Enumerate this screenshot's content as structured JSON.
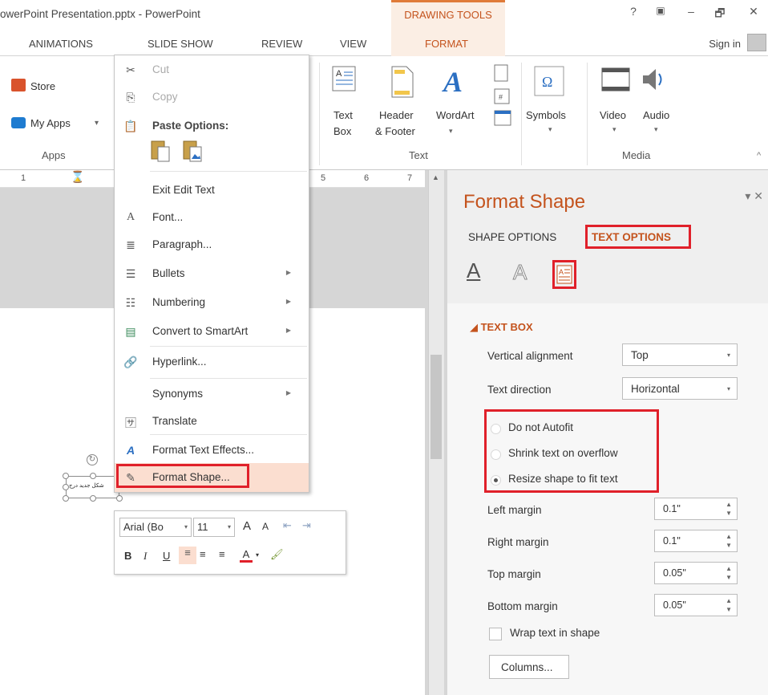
{
  "titlebar": {
    "title": "owerPoint Presentation.pptx - PowerPoint",
    "contextual_group": "DRAWING TOOLS",
    "help": "?",
    "ribbon_display": "▣",
    "minimize": "–",
    "restore": "🗗",
    "close": "✕"
  },
  "tabs": {
    "animations": "ANIMATIONS",
    "slide_show": "SLIDE SHOW",
    "review": "REVIEW",
    "view": "VIEW",
    "format": "FORMAT",
    "sign_in": "Sign in"
  },
  "ribbon": {
    "store": "Store",
    "my_apps": "My Apps",
    "my_apps_dd": "▾",
    "apps_group": "Apps",
    "text_box_line1": "Text",
    "text_box_line2": "Box",
    "header_line1": "Header",
    "header_line2": "& Footer",
    "wordart": "WordArt",
    "text_group": "Text",
    "symbols": "Symbols",
    "video": "Video",
    "audio": "Audio",
    "media_group": "Media",
    "collapse": "^"
  },
  "ruler": {
    "n1": "1",
    "n5": "5",
    "n6": "6",
    "n7": "7"
  },
  "context_menu": {
    "cut": "Cut",
    "copy": "Copy",
    "paste_options": "Paste Options:",
    "exit_edit_text": "Exit Edit Text",
    "font": "Font...",
    "paragraph": "Paragraph...",
    "bullets": "Bullets",
    "numbering": "Numbering",
    "convert_smartart": "Convert to SmartArt",
    "hyperlink": "Hyperlink...",
    "synonyms": "Synonyms",
    "translate": "Translate",
    "format_text_effects": "Format Text Effects...",
    "format_shape": "Format Shape..."
  },
  "mini_toolbar": {
    "font_name": "Arial (Bo",
    "font_size": "11",
    "grow": "A",
    "shrink": "A",
    "bold": "B",
    "italic": "I",
    "underline": "U",
    "font_color": "A"
  },
  "textbox": {
    "text": "شکل جدید درج"
  },
  "pane": {
    "title": "Format Shape",
    "tab_shape": "SHAPE OPTIONS",
    "tab_text": "TEXT OPTIONS",
    "section": "TEXT BOX",
    "vertical_alignment_label": "Vertical alignment",
    "vertical_alignment_value": "Top",
    "text_direction_label": "Text direction",
    "text_direction_value": "Horizontal",
    "autofit_options": [
      {
        "label": "Do not Autofit",
        "selected": false
      },
      {
        "label": "Shrink text on overflow",
        "selected": false
      },
      {
        "label": "Resize shape to fit text",
        "selected": true
      }
    ],
    "left_margin_label": "Left margin",
    "left_margin_value": "0.1\"",
    "right_margin_label": "Right margin",
    "right_margin_value": "0.1\"",
    "top_margin_label": "Top margin",
    "top_margin_value": "0.05\"",
    "bottom_margin_label": "Bottom margin",
    "bottom_margin_value": "0.05\"",
    "wrap_label": "Wrap text in shape",
    "wrap_checked": false,
    "columns_button": "Columns..."
  },
  "colors": {
    "accent": "#c4531d",
    "highlight_box": "#e0202a",
    "menu_hover": "#fbded0",
    "contextual_tab": "#fbeee4"
  }
}
